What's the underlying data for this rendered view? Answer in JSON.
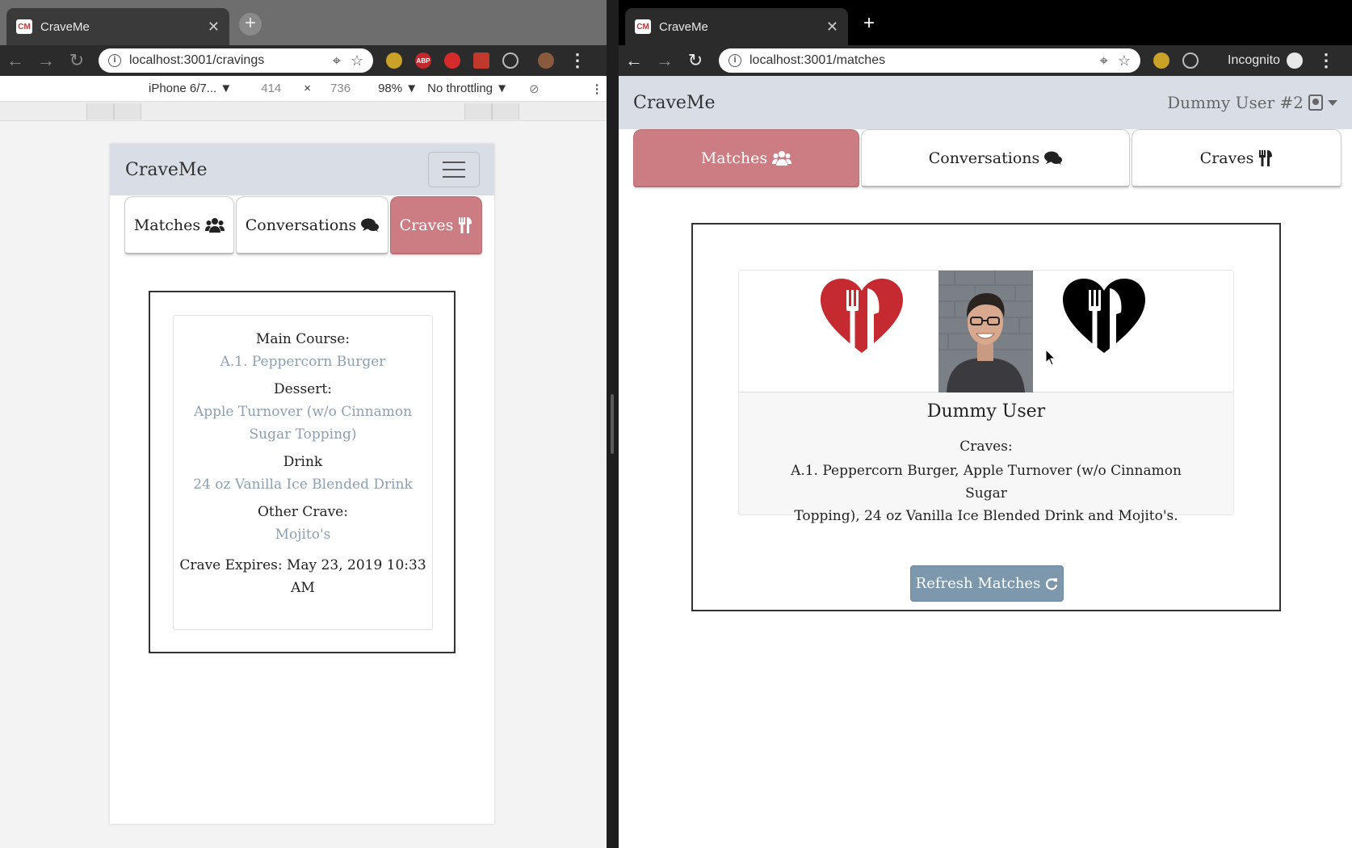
{
  "left_window": {
    "tab_title": "CraveMe",
    "favicon_text": "CM",
    "url": "localhost:3001/cravings",
    "device_bar": {
      "device": "iPhone 6/7... ▼",
      "width": "414",
      "times": "×",
      "height": "736",
      "zoom": "98% ▼",
      "throttling": "No throttling ▼"
    },
    "app": {
      "brand": "CraveMe",
      "tabs": [
        "Matches",
        "Conversations",
        "Craves"
      ],
      "active_tab": "Craves",
      "crave": {
        "main_course_label": "Main Course:",
        "main_course": "A.1. Peppercorn Burger",
        "dessert_label": "Dessert:",
        "dessert_line1": "Apple Turnover (w/o Cinnamon",
        "dessert_line2": "Sugar Topping)",
        "drink_label": "Drink",
        "drink": "24 oz Vanilla Ice Blended Drink",
        "other_label": "Other Crave:",
        "other": "Mojito's",
        "expires_line1": "Crave Expires: May 23, 2019 10:33",
        "expires_line2": "AM"
      }
    }
  },
  "right_window": {
    "tab_title": "CraveMe",
    "favicon_text": "CM",
    "url": "localhost:3001/matches",
    "incognito_label": "Incognito",
    "app": {
      "brand": "CraveMe",
      "user_menu": "Dummy User #2",
      "tabs": [
        "Matches",
        "Conversations",
        "Craves"
      ],
      "active_tab": "Matches",
      "match": {
        "name": "Dummy User",
        "craves_label": "Craves:",
        "craves_line1": "A.1. Peppercorn Burger, Apple Turnover (w/o Cinnamon Sugar",
        "craves_line2": "Topping), 24 oz Vanilla Ice Blended Drink and Mojito's."
      },
      "refresh_button": "Refresh Matches"
    }
  },
  "colors": {
    "nav_bg": "#d9dee6",
    "active_tab": "#cc7d84",
    "link_text": "#8e9fb0",
    "refresh_button": "#7d97ad",
    "heart_red": "#c42a2f",
    "heart_black": "#000000"
  },
  "icons": [
    "users-icon",
    "comments-icon",
    "utensils-icon",
    "refresh-icon",
    "heart-utensils-icon",
    "user-badge-icon"
  ]
}
